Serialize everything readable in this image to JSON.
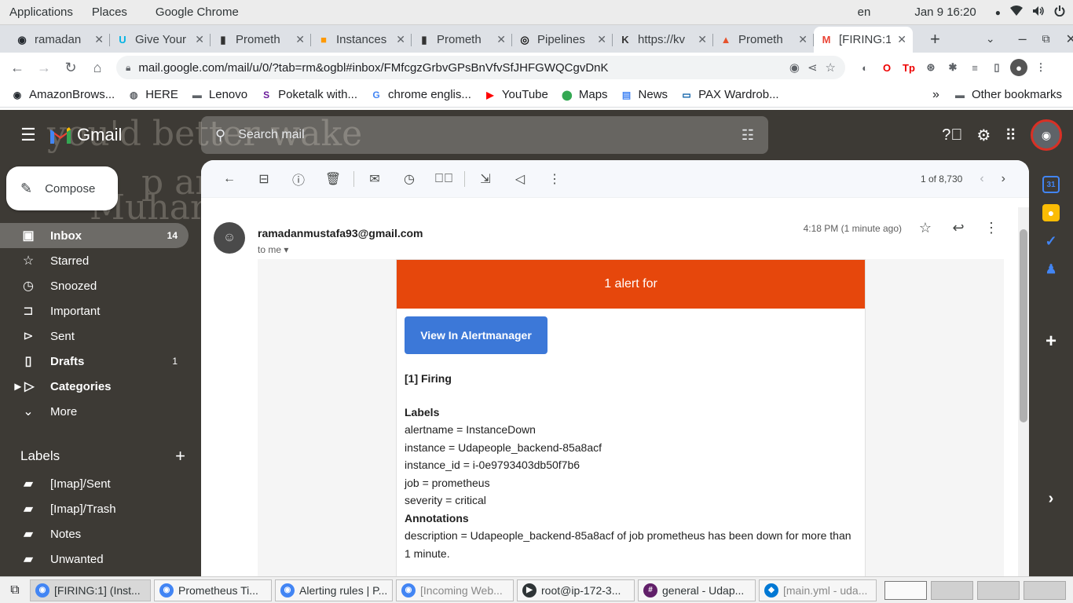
{
  "topbar": {
    "applications": "Applications",
    "places": "Places",
    "app": "Google Chrome",
    "lang": "en",
    "datetime": "Jan 9  16:20"
  },
  "tabs": [
    {
      "title": "ramadan",
      "icon": "github-icon",
      "color": "#24292f"
    },
    {
      "title": "Give Your",
      "icon": "udacity-icon",
      "color": "#02b3e4"
    },
    {
      "title": "Prometh",
      "icon": "mail-icon",
      "color": "#333"
    },
    {
      "title": "Instances",
      "icon": "aws-icon",
      "color": "#ff9900"
    },
    {
      "title": "Prometh",
      "icon": "mail-icon",
      "color": "#333"
    },
    {
      "title": "Pipelines",
      "icon": "circleci-icon",
      "color": "#161616"
    },
    {
      "title": "https://kv",
      "icon": "kv-icon",
      "color": "#333"
    },
    {
      "title": "Prometh",
      "icon": "prometheus-icon",
      "color": "#e6522c"
    },
    {
      "title": "[FIRING:1",
      "icon": "gmail-icon",
      "color": "#ea4335",
      "active": true
    }
  ],
  "toolbar": {
    "url": "mail.google.com/mail/u/0/?tab=rm&ogbl#inbox/FMfcgzGrbvGPsBnVfvSfJHFGWQCgvDnK"
  },
  "bookmarks": [
    {
      "label": "AmazonBrows...",
      "icon": "github-icon"
    },
    {
      "label": "HERE",
      "icon": "globe-icon"
    },
    {
      "label": "Lenovo",
      "icon": "folder-icon"
    },
    {
      "label": "Poketalk with...",
      "icon": "s-icon"
    },
    {
      "label": "chrome englis...",
      "icon": "google-icon"
    },
    {
      "label": "YouTube",
      "icon": "youtube-icon"
    },
    {
      "label": "Maps",
      "icon": "maps-icon"
    },
    {
      "label": "News",
      "icon": "news-icon"
    },
    {
      "label": "PAX Wardrob...",
      "icon": "ikea-icon"
    }
  ],
  "other_bookmarks": "Other bookmarks",
  "gmail": {
    "logo": "Gmail",
    "search_placeholder": "Search mail",
    "compose": "Compose",
    "bg_text": [
      "you'd better wake",
      "p and apologise",
      "",
      "Muham"
    ],
    "nav": [
      {
        "label": "Inbox",
        "count": "14",
        "icon": "inbox-icon",
        "selected": true
      },
      {
        "label": "Starred",
        "count": "",
        "icon": "star-icon"
      },
      {
        "label": "Snoozed",
        "count": "",
        "icon": "clock-icon"
      },
      {
        "label": "Important",
        "count": "",
        "icon": "important-icon"
      },
      {
        "label": "Sent",
        "count": "",
        "icon": "send-icon"
      },
      {
        "label": "Drafts",
        "count": "1",
        "icon": "draft-icon",
        "bold": true
      },
      {
        "label": "Categories",
        "count": "",
        "icon": "label-icon",
        "bold": true
      },
      {
        "label": "More",
        "count": "",
        "icon": "expand-icon"
      }
    ],
    "labels_title": "Labels",
    "labels": [
      "[Imap]/Sent",
      "[Imap]/Trash",
      "Notes",
      "Unwanted"
    ],
    "pager": "1 of 8,730",
    "message": {
      "sender": "ramadanmustafa93@gmail.com",
      "to": "to me",
      "time": "4:18 PM (1 minute ago)",
      "header": "1 alert for",
      "button": "View In Alertmanager",
      "firing": "[1] Firing",
      "labels_heading": "Labels",
      "labels": [
        "alertname = InstanceDown",
        "instance = Udapeople_backend-85a8acf",
        "instance_id = i-0e9793403db50f7b6",
        "job = prometheus",
        "severity = critical"
      ],
      "annotations_heading": "Annotations",
      "description": "description = Udapeople_backend-85a8acf of job prometheus has been down for more than 1 minute."
    }
  },
  "taskbar": [
    {
      "label": "[FIRING:1] (Inst...",
      "icon": "chrome-icon",
      "active": true
    },
    {
      "label": "Prometheus Ti...",
      "icon": "chrome-icon"
    },
    {
      "label": "Alerting rules | P...",
      "icon": "chrome-icon"
    },
    {
      "label": "[Incoming Web...",
      "icon": "chrome-icon",
      "dim": true
    },
    {
      "label": "root@ip-172-3...",
      "icon": "terminal-icon"
    },
    {
      "label": "general - Udap...",
      "icon": "slack-icon"
    },
    {
      "label": "[main.yml - uda...",
      "icon": "vscode-icon",
      "dim": true
    }
  ],
  "colors": {
    "alert_header": "#e6470c",
    "button": "#3c78d8"
  }
}
